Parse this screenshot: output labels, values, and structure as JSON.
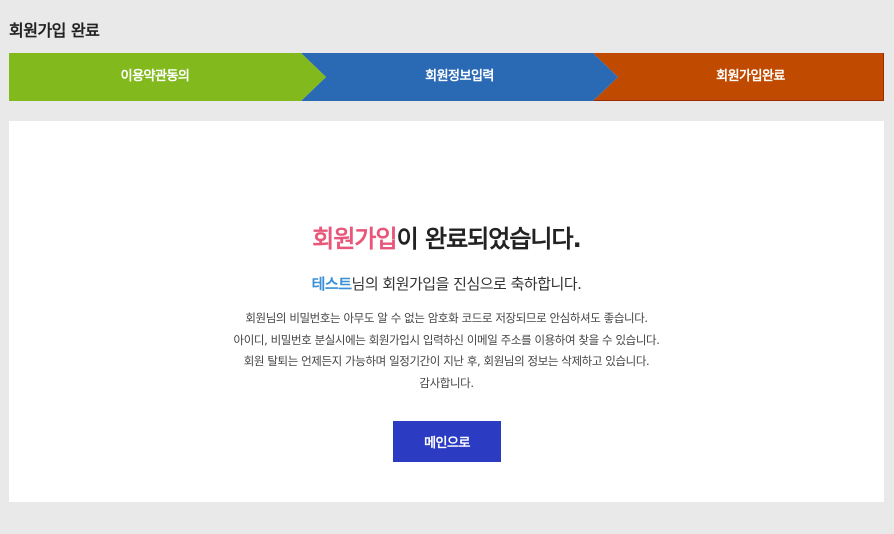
{
  "page": {
    "title": "회원가입 완료"
  },
  "steps": [
    {
      "label": "이용약관동의",
      "color": "#82b91d"
    },
    {
      "label": "회원정보입력",
      "color": "#2a6ab5"
    },
    {
      "label": "회원가입완료",
      "color": "#c04b00"
    }
  ],
  "result": {
    "headline_accent": "회원가입",
    "headline_rest": "이 완료되었습니다.",
    "username": "테스트",
    "congrats_rest": "님의 회원가입을 진심으로 축하합니다.",
    "notes": [
      "회원님의 비밀번호는 아무도 알 수 없는 암호화 코드로 저장되므로 안심하셔도 좋습니다.",
      "아이디, 비밀번호 분실시에는 회원가입시 입력하신 이메일 주소를 이용하여 찾을 수 있습니다.",
      "회원 탈퇴는 언제든지 가능하며 일정기간이 지난 후, 회원님의 정보는 삭제하고 있습니다.",
      "감사합니다."
    ],
    "main_button_label": "메인으로"
  },
  "colors": {
    "accent_pink": "#e8577a",
    "user_blue": "#3a8fd6",
    "button_blue": "#2b3bc2"
  }
}
